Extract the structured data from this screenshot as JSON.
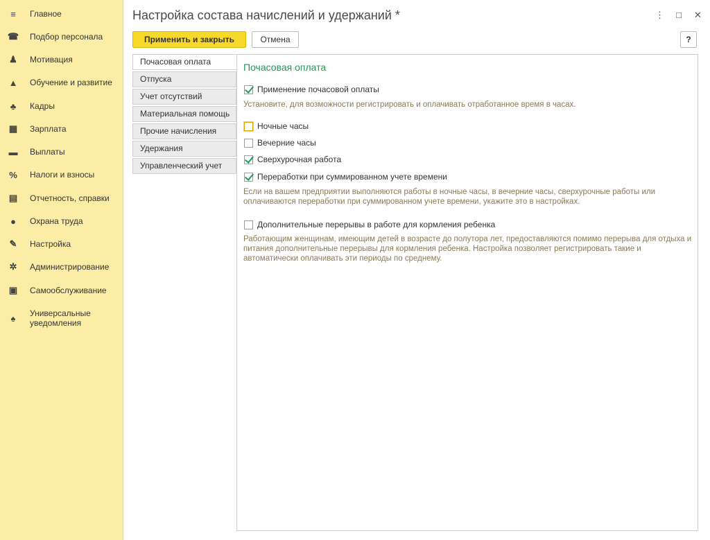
{
  "sidebar": {
    "items": [
      {
        "icon": "menu-icon",
        "glyph": "≡",
        "label": "Главное"
      },
      {
        "icon": "headset-icon",
        "glyph": "☎",
        "label": "Подбор персонала"
      },
      {
        "icon": "people-icon",
        "glyph": "♟",
        "label": "Мотивация"
      },
      {
        "icon": "graduation-cap-icon",
        "glyph": "▲",
        "label": "Обучение и развитие"
      },
      {
        "icon": "users-icon",
        "glyph": "♣",
        "label": "Кадры"
      },
      {
        "icon": "calculator-icon",
        "glyph": "▦",
        "label": "Зарплата"
      },
      {
        "icon": "card-icon",
        "glyph": "▬",
        "label": "Выплаты"
      },
      {
        "icon": "percent-icon",
        "glyph": "%",
        "label": "Налоги и взносы"
      },
      {
        "icon": "report-icon",
        "glyph": "▤",
        "label": "Отчетность, справки"
      },
      {
        "icon": "helmet-icon",
        "glyph": "●",
        "label": "Охрана труда"
      },
      {
        "icon": "wrench-icon",
        "glyph": "✎",
        "label": "Настройка"
      },
      {
        "icon": "gear-icon",
        "glyph": "✲",
        "label": "Администрирование"
      },
      {
        "icon": "self-service-icon",
        "glyph": "▣",
        "label": "Самообслуживание"
      },
      {
        "icon": "bell-icon",
        "glyph": "♠",
        "label": "Универсальные уведомления"
      }
    ]
  },
  "window": {
    "title": "Настройка состава начислений и удержаний *",
    "controls": {
      "more": "⋮",
      "maximize": "□",
      "close": "✕"
    }
  },
  "toolbar": {
    "apply_label": "Применить и закрыть",
    "cancel_label": "Отмена",
    "help_label": "?"
  },
  "tabs": [
    {
      "label": "Почасовая оплата",
      "active": true
    },
    {
      "label": "Отпуска",
      "active": false
    },
    {
      "label": "Учет отсутствий",
      "active": false
    },
    {
      "label": "Материальная помощь",
      "active": false
    },
    {
      "label": "Прочие начисления",
      "active": false
    },
    {
      "label": "Удержания",
      "active": false
    },
    {
      "label": "Управленческий учет",
      "active": false
    }
  ],
  "content": {
    "section_title": "Почасовая оплата",
    "hourly_pay": {
      "label": "Применение почасовой оплаты",
      "checked": true
    },
    "hourly_pay_hint": "Установите, для возможности регистрировать и оплачивать отработанное время в часах.",
    "night_hours": {
      "label": "Ночные часы",
      "checked": false
    },
    "evening_hours": {
      "label": "Вечерние часы",
      "checked": false
    },
    "overtime": {
      "label": "Сверхурочная работа",
      "checked": true
    },
    "summed_overtime": {
      "label": "Переработки при суммированном учете времени",
      "checked": true
    },
    "overtime_hint": "Если на вашем предприятии выполняются работы в ночные часы, в вечерние часы, сверхурочные работы или оплачиваются переработки при суммированном учете времени, укажите это в настройках.",
    "feeding_breaks": {
      "label": "Дополнительные перерывы в работе для кормления ребенка",
      "checked": false
    },
    "feeding_breaks_hint": "Работающим женщинам, имеющим детей в возрасте до полутора лет, предоставляются помимо перерыва для отдыха и питания дополнительные перерывы для кормления ребенка. Настройка позволяет регистрировать такие и автоматически оплачивать эти периоды по среднему."
  }
}
